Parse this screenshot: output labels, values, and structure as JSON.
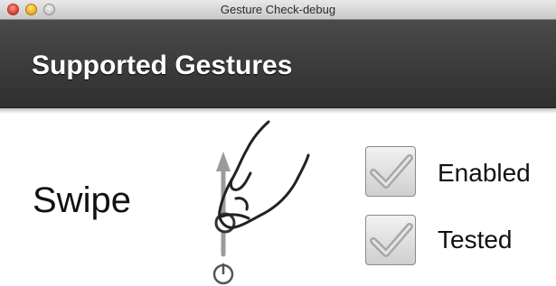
{
  "window": {
    "title": "Gesture Check-debug"
  },
  "header": {
    "title": "Supported Gestures"
  },
  "gesture": {
    "name": "Swipe",
    "icon": "swipe-up-gesture-icon",
    "enabled": {
      "label": "Enabled",
      "checked": true
    },
    "tested": {
      "label": "Tested",
      "checked": true
    }
  },
  "colors": {
    "header_bg": "#3a3a3a",
    "header_text": "#ffffff",
    "close": "#e0443a",
    "minimize": "#f2b21e",
    "zoom": "#cfcfcf"
  }
}
